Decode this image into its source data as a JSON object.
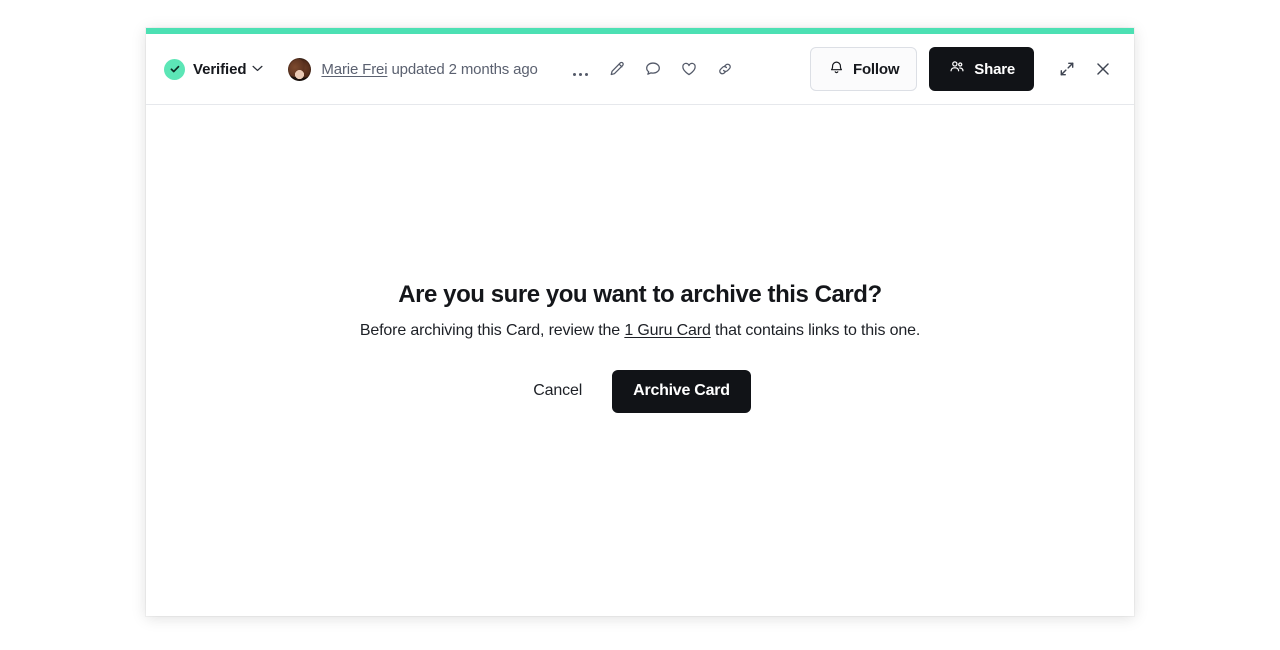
{
  "window": {
    "accent_color": "#4ce0b3"
  },
  "header": {
    "verified": {
      "label": "Verified",
      "check_icon": "check-icon",
      "chevron_icon": "chevron-down-icon",
      "badge_color": "#5ce6b6"
    },
    "avatar_icon": "avatar",
    "author": "Marie Frei",
    "updated_text": " updated 2 months ago",
    "icons": [
      {
        "name": "more-options-icon",
        "glyph": "ellipsis"
      },
      {
        "name": "edit-icon",
        "glyph": "pencil"
      },
      {
        "name": "comment-icon",
        "glyph": "speech-bubble"
      },
      {
        "name": "favorite-icon",
        "glyph": "heart"
      },
      {
        "name": "copy-link-icon",
        "glyph": "link"
      }
    ],
    "follow_label": "Follow",
    "follow_icon": "bell-icon",
    "share_label": "Share",
    "share_icon": "people-icon",
    "expand_icon": "expand-icon",
    "close_icon": "close-icon"
  },
  "dialog": {
    "title": "Are you sure you want to archive this Card?",
    "subtitle_before": "Before archiving this Card, review the ",
    "subtitle_link": "1 Guru Card",
    "subtitle_after": " that contains links to this one.",
    "cancel_label": "Cancel",
    "archive_label": "Archive Card",
    "archive_bg": "#111317"
  }
}
